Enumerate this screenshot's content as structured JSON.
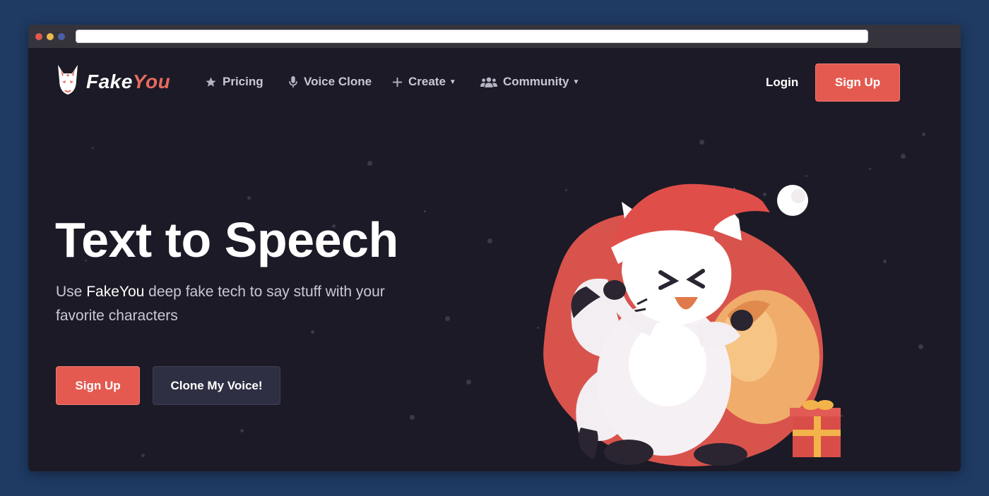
{
  "brand": {
    "name_part1": "Fake",
    "name_part2": "You",
    "logo_icon": "kitsune-mask-icon",
    "accent_color": "#e66a5e"
  },
  "nav": {
    "items": [
      {
        "label": "Pricing",
        "icon": "star-icon"
      },
      {
        "label": "Voice Clone",
        "icon": "microphone-icon"
      },
      {
        "label": "Create",
        "icon": "plus-icon",
        "dropdown": true
      },
      {
        "label": "Community",
        "icon": "users-icon",
        "dropdown": true
      }
    ],
    "login_label": "Login",
    "signup_label": "Sign Up"
  },
  "hero": {
    "title": "Text to Speech",
    "subtitle_prefix": "Use ",
    "subtitle_brand": "FakeYou",
    "subtitle_suffix": " deep fake tech to say stuff with your favorite characters",
    "signup_label": "Sign Up",
    "clone_label": "Clone My Voice!"
  },
  "colors": {
    "page_background": "#1b1a26",
    "button_red": "#e45a51",
    "button_dark": "#2f2f43",
    "outer_background": "#1f3a63"
  }
}
